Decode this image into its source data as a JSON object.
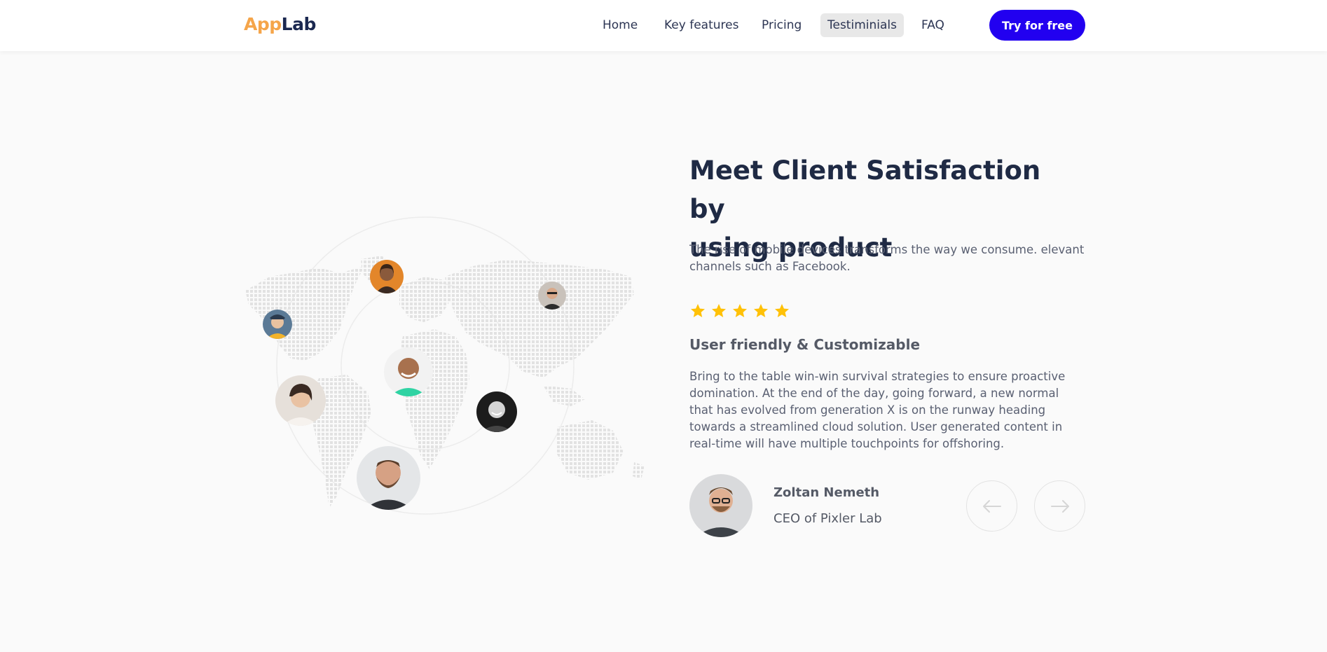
{
  "header": {
    "logo_part1": "App",
    "logo_part2": "Lab",
    "nav": [
      "Home",
      "Key features",
      "Pricing",
      "Testiminials",
      "FAQ"
    ],
    "active_nav": "Testiminials",
    "cta_label": "Try for free"
  },
  "testimonial": {
    "title_line1": "Meet Client Satisfaction by",
    "title_line2": "using product",
    "lead": "The rise of mobile devices transforms the way we consume. elevant channels such as Facebook.",
    "rating": 5,
    "subheading": "User friendly & Customizable",
    "body": "Bring to the table win-win survival strategies to ensure proactive domination. At the end of the day, going forward, a new normal that has evolved from generation X is on the runway heading towards a streamlined cloud solution. User generated content in real-time will have multiple touchpoints for offshoring.",
    "author_name": "Zoltan Nemeth",
    "author_role": "CEO of Pixler Lab",
    "prev_icon": "arrow-left-icon",
    "next_icon": "arrow-right-icon"
  },
  "colors": {
    "accent": "#2200f0",
    "logo_orange": "#f5a54a",
    "star": "#ffc107",
    "title": "#1f2a44"
  }
}
